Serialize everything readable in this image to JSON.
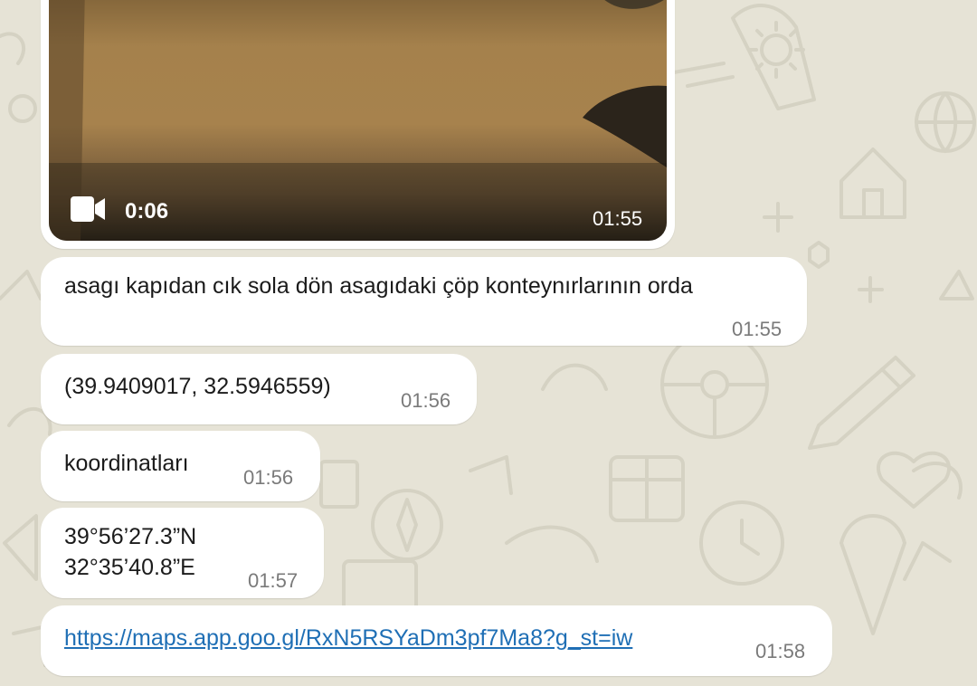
{
  "colors": {
    "wallpaper": "#e6e3d6",
    "bubble": "#ffffff",
    "text": "#1b1b1b",
    "timestamp": "#7a7a7a",
    "link": "#1f6fb5"
  },
  "video_message": {
    "icon": "video-camera-icon",
    "duration": "0:06",
    "time": "01:55"
  },
  "messages": [
    {
      "lines": [
        "asagı kapıdan cık sola dön asagıdaki çöp konteynırlarının orda"
      ],
      "time": "01:55"
    },
    {
      "lines": [
        "(39.9409017, 32.5946559)"
      ],
      "time": "01:56"
    },
    {
      "lines": [
        "koordinatları"
      ],
      "time": "01:56"
    },
    {
      "lines": [
        "39°56’27.3”N",
        "32°35’40.8”E"
      ],
      "time": "01:57"
    },
    {
      "lines": [
        "https://maps.app.goo.gl/RxN5RSYaDm3pf7Ma8?g_st=iw"
      ],
      "time": "01:58",
      "is_link": true
    }
  ]
}
